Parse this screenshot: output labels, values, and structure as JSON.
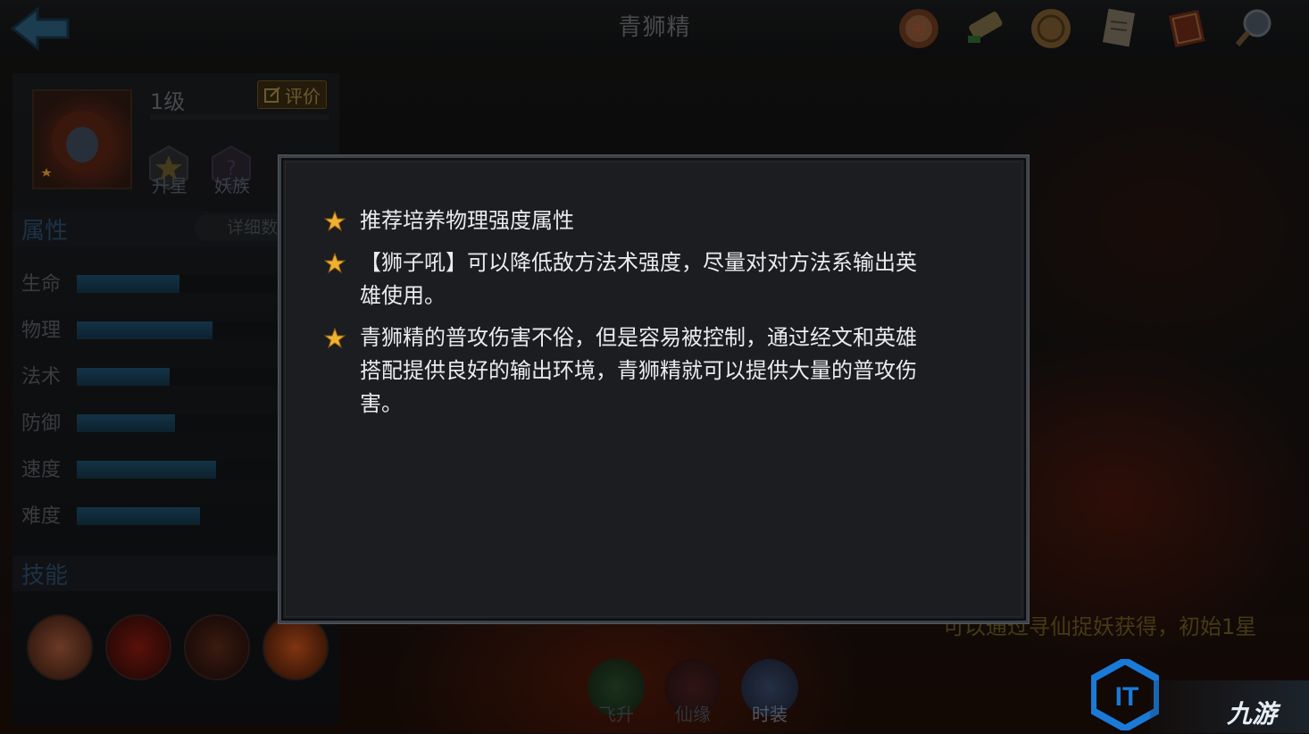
{
  "header": {
    "title": "青狮精"
  },
  "top_icons": [
    "seal-icon",
    "scroll-icon",
    "coin-icon",
    "document-icon",
    "book-icon",
    "magnifier-icon"
  ],
  "hero": {
    "level": "1级",
    "eval_label": "评价",
    "badges": [
      {
        "label": "升星"
      },
      {
        "label": "妖族"
      }
    ]
  },
  "attributes": {
    "title": "属性",
    "detail_label": "详细数",
    "stats": [
      {
        "label": "生命",
        "value": 0.5
      },
      {
        "label": "物理",
        "value": 0.66
      },
      {
        "label": "法术",
        "value": 0.45
      },
      {
        "label": "防御",
        "value": 0.48
      },
      {
        "label": "速度",
        "value": 0.68
      },
      {
        "label": "难度",
        "value": 0.6
      }
    ]
  },
  "skills": {
    "title": "技能",
    "icons": [
      "skill-1-icon",
      "skill-2-icon",
      "skill-3-icon",
      "skill-4-icon"
    ]
  },
  "bottom_buttons": [
    {
      "label": "飞升"
    },
    {
      "label": "仙缘"
    },
    {
      "label": "时装"
    }
  ],
  "obtain_text": "可以通过寻仙捉妖获得，初始1星",
  "watermark": "九游",
  "dialog": {
    "tips": [
      {
        "line1": "推荐培养物理强度属性"
      },
      {
        "line1": "【狮子吼】可以降低敌方法术强度，尽量对对方法系输出英",
        "line2": "雄使用。"
      },
      {
        "line1": "青狮精的普攻伤害不俗，但是容易被控制，通过经文和英雄",
        "line2": "搭配提供良好的输出环境，青狮精就可以提供大量的普攻伤",
        "line3": "害。"
      }
    ]
  },
  "colors": {
    "star": "#f0b030",
    "bar_fill": "#1f4e6c",
    "dialog_bg": "#1b1d20"
  }
}
